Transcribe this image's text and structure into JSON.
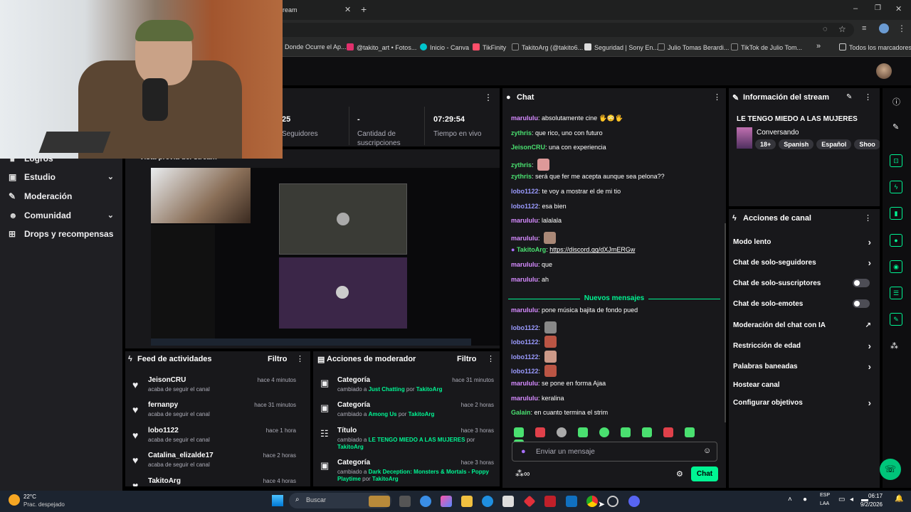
{
  "browser": {
    "tab_title": "ream",
    "bookmarks": [
      "Donde Ocurre el Ap...",
      "@takito_art • Fotos...",
      "Inicio - Canva",
      "TikFinity",
      "TakitoArg (@takito6...",
      "Seguridad | Sony En...",
      "Julio Tomas Berardi...",
      "TikTok de Julio Tom..."
    ],
    "bookmarks_overflow": "»",
    "all_bookmarks": "Todos los marcadores"
  },
  "sidebar": {
    "items": [
      {
        "label": "Logros",
        "icon": "trophy-icon"
      },
      {
        "label": "Estudio",
        "icon": "studio-icon",
        "chevron": "⌄"
      },
      {
        "label": "Moderación",
        "icon": "wrench-icon"
      },
      {
        "label": "Comunidad",
        "icon": "people-icon",
        "chevron": "⌄"
      },
      {
        "label": "Drops y recompensas",
        "icon": "gift-icon"
      }
    ]
  },
  "stats": {
    "followers_value": "25",
    "followers_label": "Seguidores",
    "subs_value": "-",
    "subs_label": "Cantidad de suscripciones",
    "live_value": "07:29:54",
    "live_label": "Tiempo en vivo",
    "preview_title": "Vista previa del stream"
  },
  "feed": {
    "title": "Feed de actividades",
    "filter": "Filtro",
    "rows": [
      {
        "name": "JeisonCRU",
        "sub": "acaba de seguir el canal",
        "time": "hace 4 minutos"
      },
      {
        "name": "fernanpy",
        "sub": "acaba de seguir el canal",
        "time": "hace 31 minutos"
      },
      {
        "name": "lobo1122",
        "sub": "acaba de seguir el canal",
        "time": "hace 1 hora"
      },
      {
        "name": "Catalina_elizalde17",
        "sub": "acaba de seguir el canal",
        "time": "hace 2 horas"
      },
      {
        "name": "TakitoArg",
        "sub": "",
        "time": "hace 4 horas"
      }
    ]
  },
  "modactions": {
    "title": "Acciones de moderador",
    "filter": "Filtro",
    "rows": [
      {
        "type": "Categoría",
        "pre": "cambiado a ",
        "value": "Just Chatting",
        "by": " por ",
        "user": "TakitoArg",
        "time": "hace 31 minutos"
      },
      {
        "type": "Categoría",
        "pre": "cambiado a ",
        "value": "Among Us",
        "by": " por ",
        "user": "TakitoArg",
        "time": "hace 2 horas"
      },
      {
        "type": "Título",
        "pre": "cambiado a ",
        "value": "LE TENGO MIEDO A LAS MUJERES",
        "by": " por ",
        "user": "TakitoArg",
        "time": "hace 3 horas"
      },
      {
        "type": "Categoría",
        "pre": "cambiado a ",
        "value": "Dark Deception: Monsters & Mortals - Poppy Playtime",
        "by": " por ",
        "user": "TakitoArg",
        "time": "hace 3 horas"
      }
    ]
  },
  "chat": {
    "title": "Chat",
    "messages": [
      {
        "user": "marululu",
        "color": "purple",
        "text": "absolutamente cine 🖐😳🖐"
      },
      {
        "user": "zythris",
        "color": "green",
        "text": "que rico, uno con futuro"
      },
      {
        "user": "JeisonCRU",
        "color": "green",
        "text": "una con experiencia"
      },
      {
        "user": "zythris",
        "color": "green",
        "text": "",
        "emote": "#d99"
      },
      {
        "user": "zythris",
        "color": "green",
        "text": "será que fer me acepta aunque sea pelona??"
      },
      {
        "user": "lobo1122",
        "color": "blue",
        "text": "te voy a mostrar el de mi tio"
      },
      {
        "user": "lobo1122",
        "color": "blue",
        "text": "esa bien"
      },
      {
        "user": "marululu",
        "color": "purple",
        "text": "lalalala"
      },
      {
        "user": "marululu",
        "color": "purple",
        "text": "",
        "emote": "#a87"
      },
      {
        "user": "TakitoArg",
        "color": "green",
        "text": "https://discord.gg/dXJmERGw"
      },
      {
        "user": "marululu",
        "color": "purple",
        "text": "que"
      },
      {
        "user": "marululu",
        "color": "purple",
        "text": "ah"
      }
    ],
    "divider": "Nuevos mensajes",
    "new_messages": [
      {
        "user": "marululu",
        "color": "purple",
        "text": "pone música bajita de fondo pued"
      },
      {
        "user": "lobo1122",
        "color": "blue",
        "text": "",
        "emote": "#888"
      },
      {
        "user": "lobo1122",
        "color": "blue",
        "text": "",
        "emote": "#b54"
      },
      {
        "user": "lobo1122",
        "color": "blue",
        "text": "",
        "emote": "#c98"
      },
      {
        "user": "lobo1122",
        "color": "blue",
        "text": "",
        "emote": "#b54"
      },
      {
        "user": "marululu",
        "color": "purple",
        "text": "se pone en forma Ajaa"
      },
      {
        "user": "marululu",
        "color": "purple",
        "text": "keralina"
      },
      {
        "user": "Galain",
        "color": "green",
        "text": "en cuanto termina el strim"
      }
    ],
    "input_placeholder": "Enviar un mensaje",
    "send_button": "Chat"
  },
  "stream_info": {
    "title": "Información del stream",
    "stream_title": "LE TENGO MIEDO A LAS MUJERES",
    "category": "Conversando",
    "tags": [
      "18+",
      "Spanish",
      "Español",
      "Shoo"
    ]
  },
  "channel_actions": {
    "title": "Acciones de canal",
    "items": [
      {
        "label": "Modo lento",
        "kind": "arrow"
      },
      {
        "label": "Chat de solo-seguidores",
        "kind": "arrow"
      },
      {
        "label": "Chat de solo-suscriptores",
        "kind": "toggle"
      },
      {
        "label": "Chat de solo-emotes",
        "kind": "toggle"
      },
      {
        "label": "Moderación del chat con IA",
        "kind": "external"
      },
      {
        "label": "Restricción de edad",
        "kind": "arrow"
      },
      {
        "label": "Palabras baneadas",
        "kind": "arrow"
      },
      {
        "label": "Hostear canal",
        "kind": "none"
      },
      {
        "label": "Configurar objetivos",
        "kind": "arrow"
      }
    ]
  },
  "taskbar": {
    "weather_temp": "22°C",
    "weather_desc": "Prac. despejado",
    "search_placeholder": "Buscar",
    "lang1": "ESP",
    "lang2": "LAA",
    "time": "06:17",
    "date": "9/2/2026"
  },
  "colors": {
    "accent": "#00f593",
    "panel": "#18181b",
    "purple_user": "#d68bff"
  }
}
